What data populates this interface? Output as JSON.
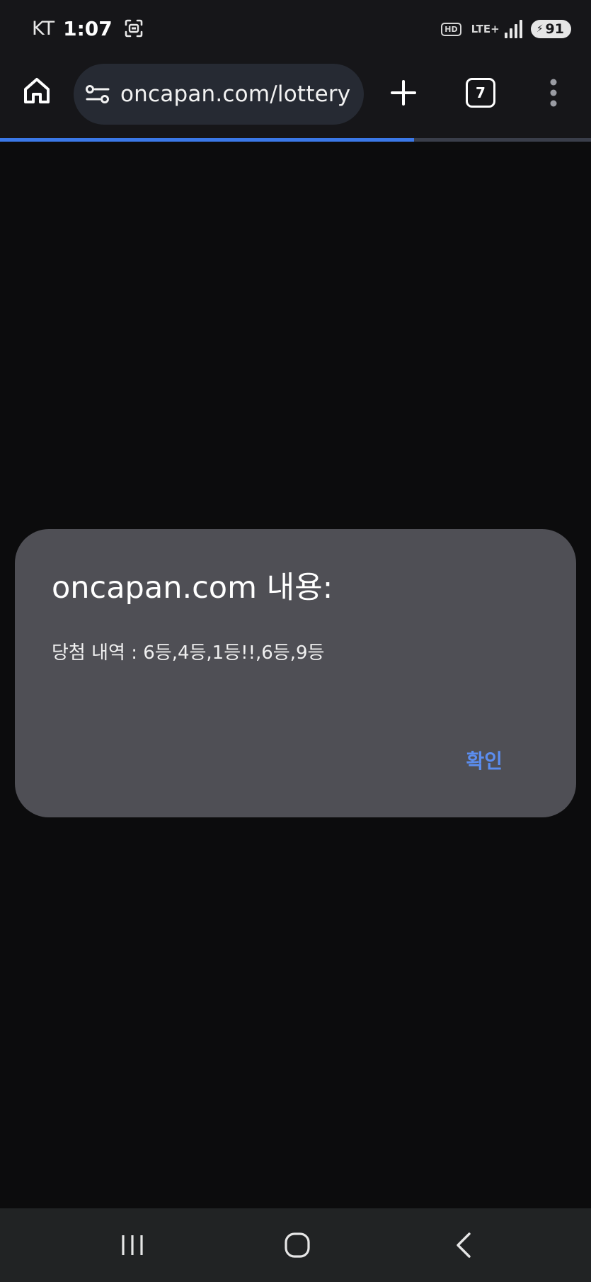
{
  "status_bar": {
    "carrier": "KT",
    "time": "1:07",
    "hd_label": "HD",
    "network_label": "LTE+",
    "battery_level": "91",
    "icons": [
      "screen-capture-icon",
      "hd-voice-icon",
      "lte-data-icon",
      "signal-bars-icon",
      "battery-charging-icon"
    ]
  },
  "browser": {
    "url": "oncapan.com/lottery",
    "tab_count": "7",
    "page_load_progress": 0.7,
    "icons": [
      "home-icon",
      "site-settings-icon",
      "new-tab-icon",
      "tab-switcher-icon",
      "more-vert-icon"
    ]
  },
  "dialog": {
    "title": "oncapan.com 내용:",
    "message": "당첨 내역 : 6등,4등,1등!!,6등,9등",
    "ok_label": "확인"
  },
  "nav_bar": {
    "icons": [
      "recents-icon",
      "home-circle-icon",
      "back-chevron-icon"
    ]
  },
  "colors": {
    "background": "#0c0c0d",
    "toolbar": "#161619",
    "url_bar": "#262a33",
    "dialog": "#4f4f55",
    "accent": "#5b8def",
    "progress": "#3b78e7",
    "nav_bar": "#212324"
  }
}
